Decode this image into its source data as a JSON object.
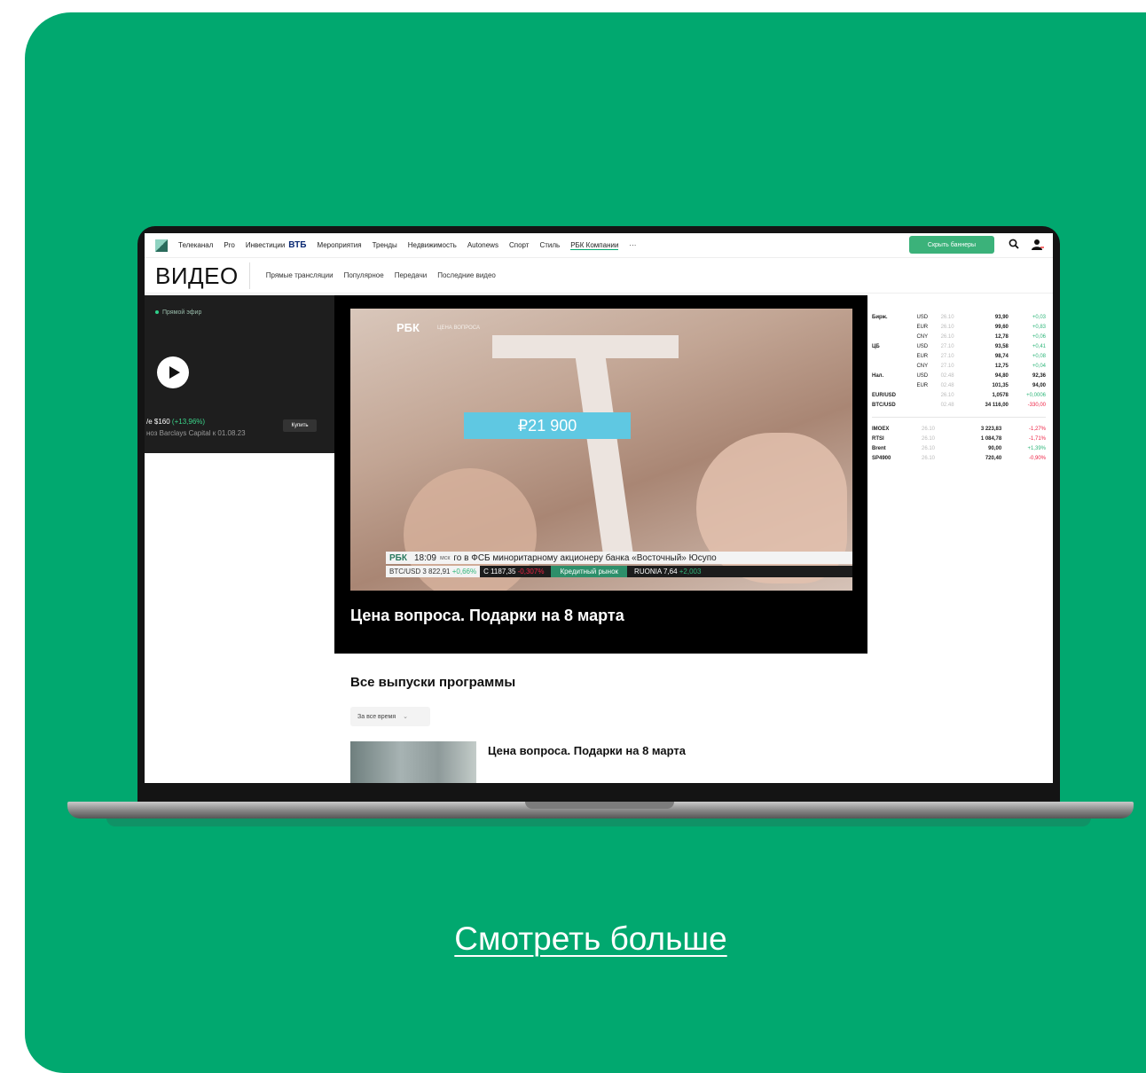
{
  "site": {
    "nav": [
      "Телеканал",
      "Pro",
      "Инвестиции"
    ],
    "nav_brand": "ВТБ",
    "nav_more": [
      "Мероприятия",
      "Тренды",
      "Недвижимость",
      "Autonews",
      "Спорт",
      "Стиль",
      "РБК Компании",
      "···"
    ],
    "hide_banners": "Скрыть баннеры",
    "section_title": "ВИДЕО",
    "subnav": [
      "Прямые трансляции",
      "Популярное",
      "Передачи",
      "Последние видео"
    ]
  },
  "sidebar": {
    "live": "Прямой эфир",
    "promo_line1_prefix": "/е $160 ",
    "promo_line1_change": "(+13,96%)",
    "promo_line2": "ноз Barclays Capital к 01.08.23",
    "buy": "Купить"
  },
  "player": {
    "logo": "РБК",
    "program": "ЦЕНА ВОПРОСА",
    "price": "₽21 900",
    "ticker_logo": "РБК",
    "ticker_time": "18:09",
    "ticker_msk": "мск",
    "ticker_text": "го в ФСБ миноритарному акционеру банка «Восточный» Юсупо",
    "btc_label": "BTC/USD 3 822,91",
    "btc_change": "+0,66%",
    "index_val": "С 1187,35",
    "index_change": "-0,307%",
    "credit": "Кредитный рынок",
    "ruonia": "RUONIA 7,64",
    "ruonia_change": "+2,003",
    "caption": "Цена вопроса. Подарки на 8 марта"
  },
  "rates": [
    [
      "Бирж.",
      "USD",
      "26.10",
      "93,90",
      "+0,03",
      "pos"
    ],
    [
      "",
      "EUR",
      "26.10",
      "99,60",
      "+0,83",
      "pos"
    ],
    [
      "",
      "CNY",
      "26.10",
      "12,78",
      "+0,06",
      "pos"
    ],
    [
      "ЦБ",
      "USD",
      "27.10",
      "93,58",
      "+0,41",
      "pos"
    ],
    [
      "",
      "EUR",
      "27.10",
      "98,74",
      "+0,08",
      "pos"
    ],
    [
      "",
      "CNY",
      "27.10",
      "12,75",
      "+0,04",
      "pos"
    ],
    [
      "Нал.",
      "USD",
      "02.48",
      "94,80",
      "92,36",
      "val"
    ],
    [
      "",
      "EUR",
      "02.48",
      "101,35",
      "94,00",
      "val"
    ],
    [
      "EUR/USD",
      "",
      "26.10",
      "1,0578",
      "+0,0006",
      "pos"
    ],
    [
      "BTC/USD",
      "",
      "02.48",
      "34 116,00",
      "-330,00",
      "neg"
    ]
  ],
  "indices": [
    [
      "IMOEX",
      "26.10",
      "3 223,83",
      "-1,27%",
      "neg"
    ],
    [
      "RTSI",
      "26.10",
      "1 084,78",
      "-1,71%",
      "neg"
    ],
    [
      "Brent",
      "26.10",
      "90,00",
      "+1,39%",
      "pos"
    ],
    [
      "SP4900",
      "26.10",
      "720,40",
      "-0,90%",
      "neg"
    ]
  ],
  "episodes": {
    "title": "Все выпуски программы",
    "filter": "За все время",
    "first": "Цена вопроса. Подарки на 8 марта"
  },
  "cta": "Смотреть больше"
}
